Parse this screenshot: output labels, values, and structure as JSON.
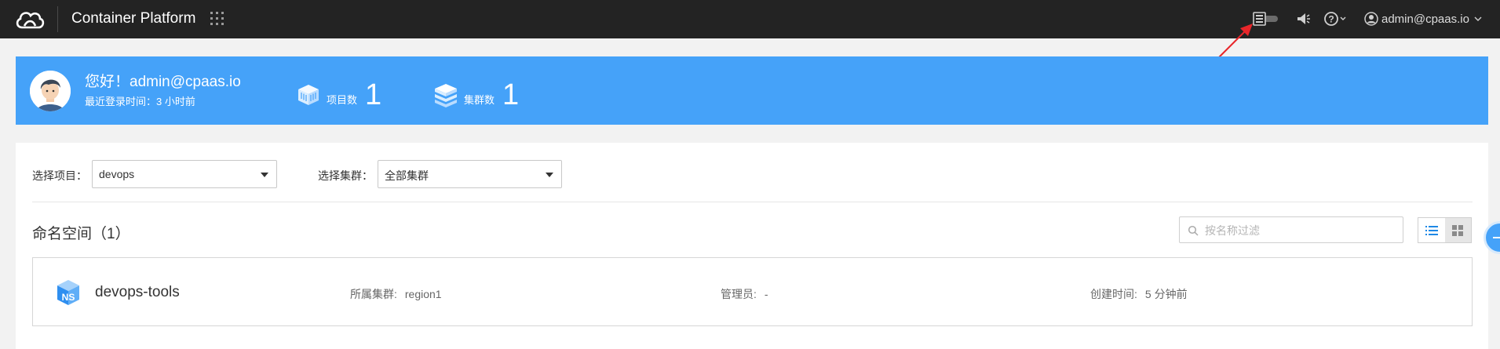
{
  "topbar": {
    "app_title": "Container Platform",
    "user_label": "admin@cpaas.io",
    "icons": [
      "cloud-logo-icon",
      "apps-grid-icon",
      "guide-toggle-icon",
      "speaker-icon",
      "help-icon",
      "user-icon",
      "chevron-down-icon"
    ]
  },
  "banner": {
    "greeting": "您好！admin@cpaas.io",
    "last_login": "最近登录时间：3 小时前",
    "stats": [
      {
        "label": "项目数",
        "value": "1",
        "icon": "projects-icon"
      },
      {
        "label": "集群数",
        "value": "1",
        "icon": "clusters-icon"
      }
    ]
  },
  "filters": {
    "project_label": "选择项目：",
    "project_value": "devops",
    "cluster_label": "选择集群：",
    "cluster_value": "全部集群"
  },
  "section": {
    "title": "命名空间（1）",
    "search_placeholder": "按名称过滤"
  },
  "namespaces": [
    {
      "name": "devops-tools",
      "cluster_label": "所属集群:",
      "cluster_value": "region1",
      "admin_label": "管理员:",
      "admin_value": "-",
      "created_label": "创建时间:",
      "created_value": "5 分钟前"
    }
  ],
  "colors": {
    "topbar": "#232323",
    "banner": "#45a2f9",
    "accent": "#1e88e5",
    "annotation": "#e8262a"
  }
}
